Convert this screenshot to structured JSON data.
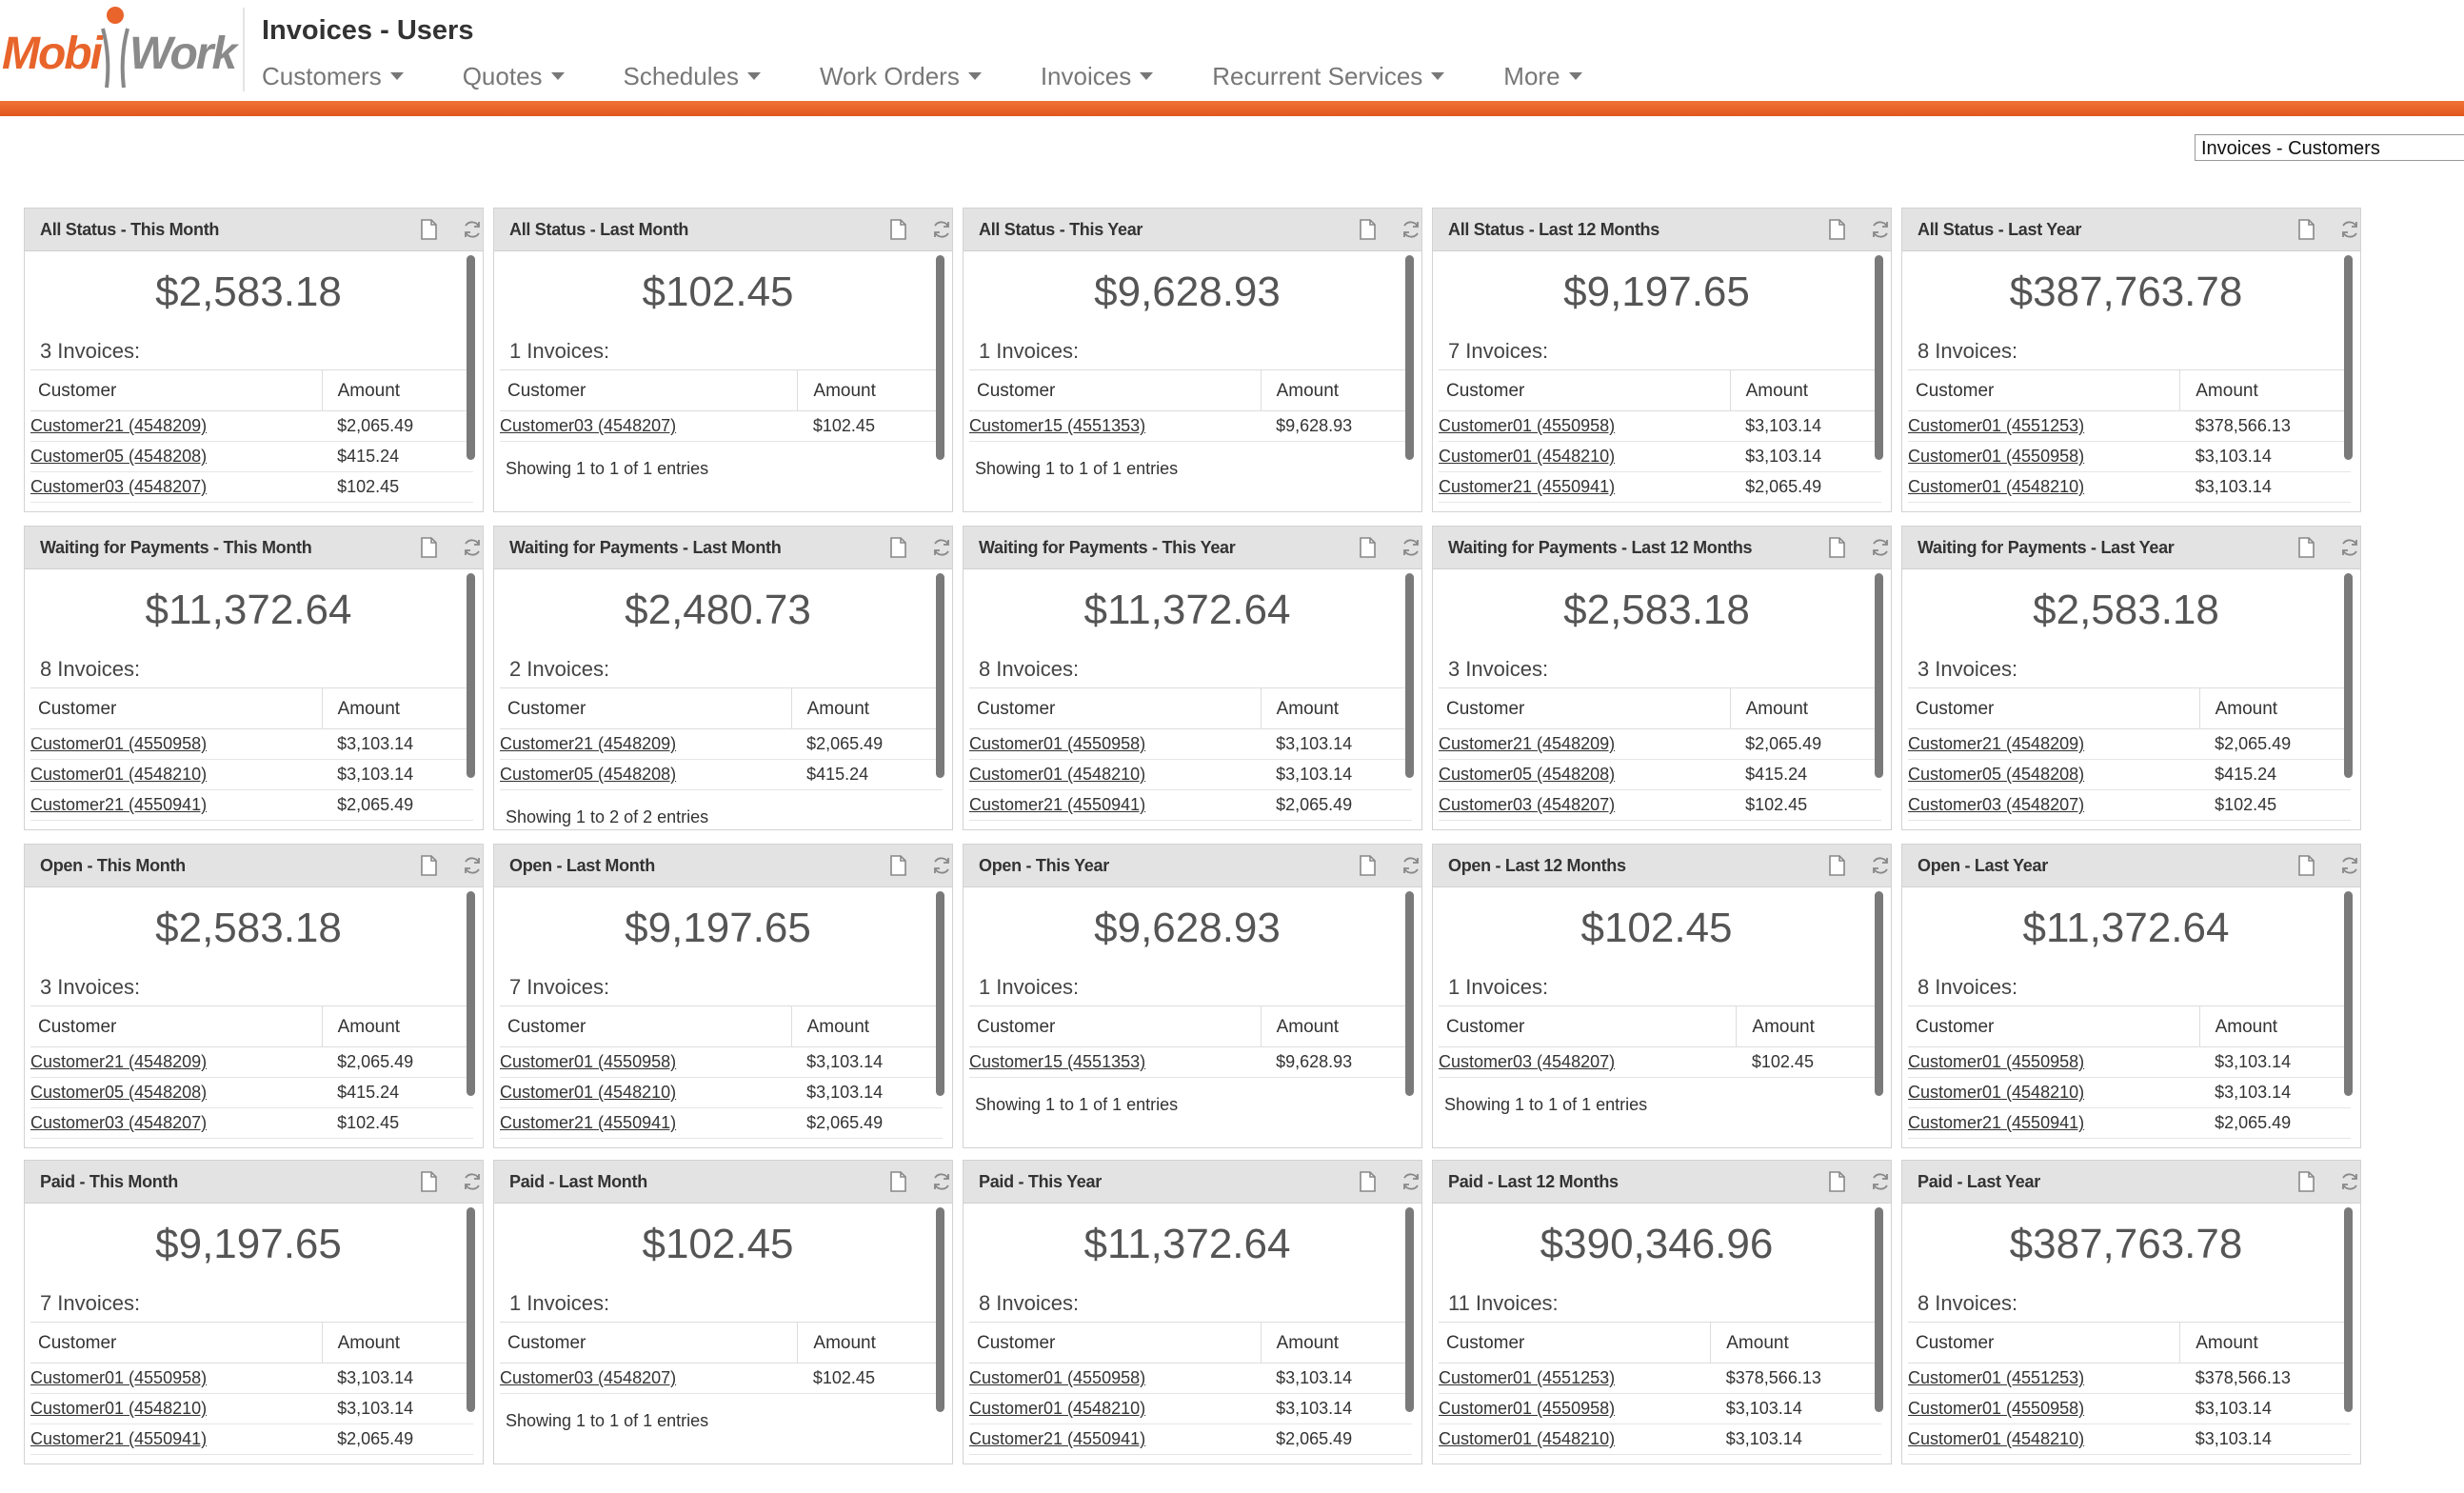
{
  "header": {
    "brand_name": "MobiWork",
    "page_title": "Invoices - Users",
    "nav": [
      "Customers",
      "Quotes",
      "Schedules",
      "Work Orders",
      "Invoices",
      "Recurrent Services",
      "More"
    ],
    "view_select": "Invoices - Customers",
    "colors": {
      "accent": "#e8642b",
      "nav_text": "#777777"
    }
  },
  "table_headers": {
    "customer": "Customer",
    "amount": "Amount"
  },
  "invoices_label": "Invoices:",
  "widgets": [
    {
      "title": "All Status - This Month",
      "amount": "$2,583.18",
      "count": "3",
      "rows": [
        [
          "Customer21 (4548209)",
          "$2,065.49"
        ],
        [
          "Customer05 (4548208)",
          "$415.24"
        ],
        [
          "Customer03 (4548207)",
          "$102.45"
        ]
      ],
      "showing": ""
    },
    {
      "title": "All Status - Last Month",
      "amount": "$102.45",
      "count": "1",
      "rows": [
        [
          "Customer03 (4548207)",
          "$102.45"
        ]
      ],
      "showing": "Showing 1 to 1 of 1 entries"
    },
    {
      "title": "All Status - This Year",
      "amount": "$9,628.93",
      "count": "1",
      "rows": [
        [
          "Customer15 (4551353)",
          "$9,628.93"
        ]
      ],
      "showing": "Showing 1 to 1 of 1 entries"
    },
    {
      "title": "All Status - Last 12 Months",
      "amount": "$9,197.65",
      "count": "7",
      "rows": [
        [
          "Customer01 (4550958)",
          "$3,103.14"
        ],
        [
          "Customer01 (4548210)",
          "$3,103.14"
        ],
        [
          "Customer21 (4550941)",
          "$2,065.49"
        ]
      ],
      "showing": ""
    },
    {
      "title": "All Status - Last Year",
      "amount": "$387,763.78",
      "count": "8",
      "rows": [
        [
          "Customer01 (4551253)",
          "$378,566.13"
        ],
        [
          "Customer01 (4550958)",
          "$3,103.14"
        ],
        [
          "Customer01 (4548210)",
          "$3,103.14"
        ]
      ],
      "showing": ""
    },
    {
      "title": "Waiting for Payments - This Month",
      "amount": "$11,372.64",
      "count": "8",
      "rows": [
        [
          "Customer01 (4550958)",
          "$3,103.14"
        ],
        [
          "Customer01 (4548210)",
          "$3,103.14"
        ],
        [
          "Customer21 (4550941)",
          "$2,065.49"
        ]
      ],
      "showing": ""
    },
    {
      "title": "Waiting for Payments - Last Month",
      "amount": "$2,480.73",
      "count": "2",
      "rows": [
        [
          "Customer21 (4548209)",
          "$2,065.49"
        ],
        [
          "Customer05 (4548208)",
          "$415.24"
        ]
      ],
      "showing": "Showing 1 to 2 of 2 entries"
    },
    {
      "title": "Waiting for Payments - This Year",
      "amount": "$11,372.64",
      "count": "8",
      "rows": [
        [
          "Customer01 (4550958)",
          "$3,103.14"
        ],
        [
          "Customer01 (4548210)",
          "$3,103.14"
        ],
        [
          "Customer21 (4550941)",
          "$2,065.49"
        ]
      ],
      "showing": ""
    },
    {
      "title": "Waiting for Payments - Last 12 Months",
      "amount": "$2,583.18",
      "count": "3",
      "rows": [
        [
          "Customer21 (4548209)",
          "$2,065.49"
        ],
        [
          "Customer05 (4548208)",
          "$415.24"
        ],
        [
          "Customer03 (4548207)",
          "$102.45"
        ]
      ],
      "showing": ""
    },
    {
      "title": "Waiting for Payments - Last Year",
      "amount": "$2,583.18",
      "count": "3",
      "rows": [
        [
          "Customer21 (4548209)",
          "$2,065.49"
        ],
        [
          "Customer05 (4548208)",
          "$415.24"
        ],
        [
          "Customer03 (4548207)",
          "$102.45"
        ]
      ],
      "showing": ""
    },
    {
      "title": "Open - This Month",
      "amount": "$2,583.18",
      "count": "3",
      "rows": [
        [
          "Customer21 (4548209)",
          "$2,065.49"
        ],
        [
          "Customer05 (4548208)",
          "$415.24"
        ],
        [
          "Customer03 (4548207)",
          "$102.45"
        ]
      ],
      "showing": ""
    },
    {
      "title": "Open - Last Month",
      "amount": "$9,197.65",
      "count": "7",
      "rows": [
        [
          "Customer01 (4550958)",
          "$3,103.14"
        ],
        [
          "Customer01 (4548210)",
          "$3,103.14"
        ],
        [
          "Customer21 (4550941)",
          "$2,065.49"
        ]
      ],
      "showing": ""
    },
    {
      "title": "Open - This Year",
      "amount": "$9,628.93",
      "count": "1",
      "rows": [
        [
          "Customer15 (4551353)",
          "$9,628.93"
        ]
      ],
      "showing": "Showing 1 to 1 of 1 entries"
    },
    {
      "title": "Open - Last 12 Months",
      "amount": "$102.45",
      "count": "1",
      "rows": [
        [
          "Customer03 (4548207)",
          "$102.45"
        ]
      ],
      "showing": "Showing 1 to 1 of 1 entries"
    },
    {
      "title": "Open - Last Year",
      "amount": "$11,372.64",
      "count": "8",
      "rows": [
        [
          "Customer01 (4550958)",
          "$3,103.14"
        ],
        [
          "Customer01 (4548210)",
          "$3,103.14"
        ],
        [
          "Customer21 (4550941)",
          "$2,065.49"
        ]
      ],
      "showing": ""
    },
    {
      "title": "Paid - This Month",
      "amount": "$9,197.65",
      "count": "7",
      "rows": [
        [
          "Customer01 (4550958)",
          "$3,103.14"
        ],
        [
          "Customer01 (4548210)",
          "$3,103.14"
        ],
        [
          "Customer21 (4550941)",
          "$2,065.49"
        ]
      ],
      "showing": ""
    },
    {
      "title": "Paid - Last Month",
      "amount": "$102.45",
      "count": "1",
      "rows": [
        [
          "Customer03 (4548207)",
          "$102.45"
        ]
      ],
      "showing": "Showing 1 to 1 of 1 entries"
    },
    {
      "title": "Paid - This Year",
      "amount": "$11,372.64",
      "count": "8",
      "rows": [
        [
          "Customer01 (4550958)",
          "$3,103.14"
        ],
        [
          "Customer01 (4548210)",
          "$3,103.14"
        ],
        [
          "Customer21 (4550941)",
          "$2,065.49"
        ]
      ],
      "showing": ""
    },
    {
      "title": "Paid - Last 12 Months",
      "amount": "$390,346.96",
      "count": "11",
      "rows": [
        [
          "Customer01 (4551253)",
          "$378,566.13"
        ],
        [
          "Customer01 (4550958)",
          "$3,103.14"
        ],
        [
          "Customer01 (4548210)",
          "$3,103.14"
        ]
      ],
      "showing": ""
    },
    {
      "title": "Paid - Last Year",
      "amount": "$387,763.78",
      "count": "8",
      "rows": [
        [
          "Customer01 (4551253)",
          "$378,566.13"
        ],
        [
          "Customer01 (4550958)",
          "$3,103.14"
        ],
        [
          "Customer01 (4548210)",
          "$3,103.14"
        ]
      ],
      "showing": ""
    }
  ]
}
